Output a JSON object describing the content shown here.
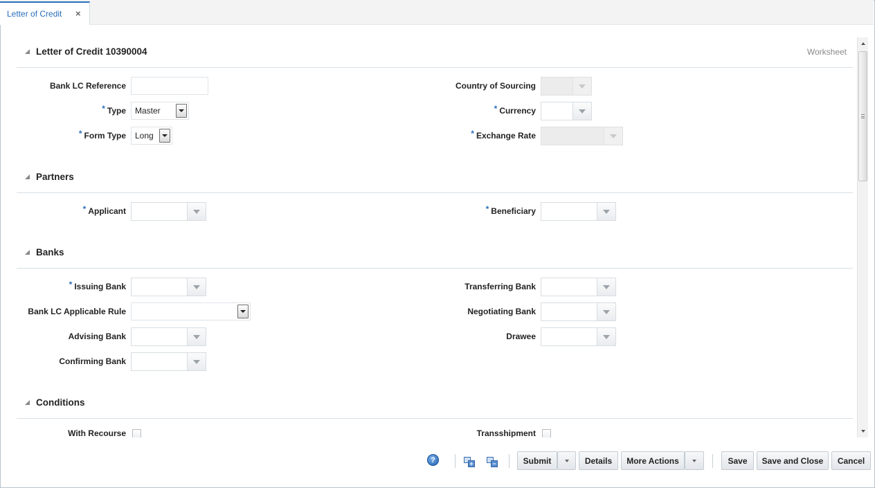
{
  "tabs": [
    {
      "label": "Letter of Credit",
      "close_icon": "×"
    }
  ],
  "header": {
    "title": "Letter of Credit 10390004",
    "status": "Worksheet"
  },
  "sections": {
    "general": {
      "bank_lc_reference": {
        "label": "Bank LC Reference",
        "value": ""
      },
      "type": {
        "label": "Type",
        "value": "Master",
        "required": true
      },
      "form_type": {
        "label": "Form Type",
        "value": "Long",
        "required": true
      },
      "country_of_sourcing": {
        "label": "Country of Sourcing",
        "value": "",
        "disabled": true
      },
      "currency": {
        "label": "Currency",
        "value": "",
        "required": true
      },
      "exchange_rate": {
        "label": "Exchange Rate",
        "value": "",
        "required": true,
        "disabled": true
      }
    },
    "partners": {
      "title": "Partners",
      "applicant": {
        "label": "Applicant",
        "value": "",
        "required": true
      },
      "beneficiary": {
        "label": "Beneficiary",
        "value": "",
        "required": true
      }
    },
    "banks": {
      "title": "Banks",
      "issuing_bank": {
        "label": "Issuing Bank",
        "value": "",
        "required": true
      },
      "bank_lc_applicable_rule": {
        "label": "Bank LC Applicable Rule",
        "value": ""
      },
      "advising_bank": {
        "label": "Advising Bank",
        "value": ""
      },
      "confirming_bank": {
        "label": "Confirming Bank",
        "value": ""
      },
      "transferring_bank": {
        "label": "Transferring Bank",
        "value": ""
      },
      "negotiating_bank": {
        "label": "Negotiating Bank",
        "value": ""
      },
      "drawee": {
        "label": "Drawee",
        "value": ""
      }
    },
    "conditions": {
      "title": "Conditions",
      "with_recourse": {
        "label": "With Recourse",
        "checked": false
      },
      "transshipment": {
        "label": "Transshipment",
        "checked": false
      }
    }
  },
  "required_marker": "*",
  "footer": {
    "help_icon": "?",
    "buttons": {
      "submit": "Submit",
      "details": "Details",
      "more_actions": "More Actions",
      "save": "Save",
      "save_and_close": "Save and Close",
      "cancel": "Cancel"
    }
  }
}
